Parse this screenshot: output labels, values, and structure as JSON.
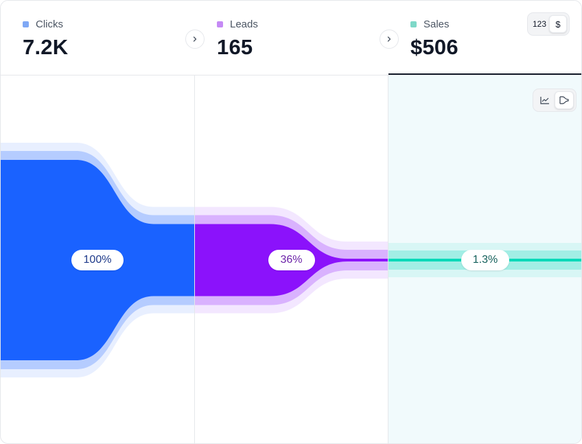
{
  "stages": [
    {
      "label": "Clicks",
      "value": "7.2K",
      "color": "#1a62ff",
      "dot": "#7fa8f5",
      "percent": "100%",
      "percent_color": "#1e3a8a",
      "percent_value": 100
    },
    {
      "label": "Leads",
      "value": "165",
      "color": "#8b12fb",
      "dot": "#c58af5",
      "percent": "36%",
      "percent_color": "#6b21a8",
      "percent_value": 36
    },
    {
      "label": "Sales",
      "value": "$506",
      "color": "#00d9b8",
      "dot": "#7ed8c8",
      "percent": "1.3%",
      "percent_color": "#115e59",
      "percent_value": 1.3
    }
  ],
  "active_stage": "Sales",
  "value_toggle": {
    "options": [
      "123",
      "$"
    ],
    "selected": "$"
  },
  "view_toggle": {
    "options": [
      "line-chart-icon",
      "funnel-chart-icon"
    ],
    "selected": "funnel-chart-icon"
  },
  "icons": {
    "chevron": "chevron-right-icon"
  },
  "chart_data": {
    "type": "area",
    "categories": [
      "Clicks",
      "Leads",
      "Sales"
    ],
    "values": [
      100,
      36,
      1.3
    ],
    "labels": [
      "100%",
      "36%",
      "1.3%"
    ],
    "raw_values": [
      "7.2K",
      "165",
      "$506"
    ],
    "title": "",
    "xlabel": "",
    "ylabel": ""
  }
}
